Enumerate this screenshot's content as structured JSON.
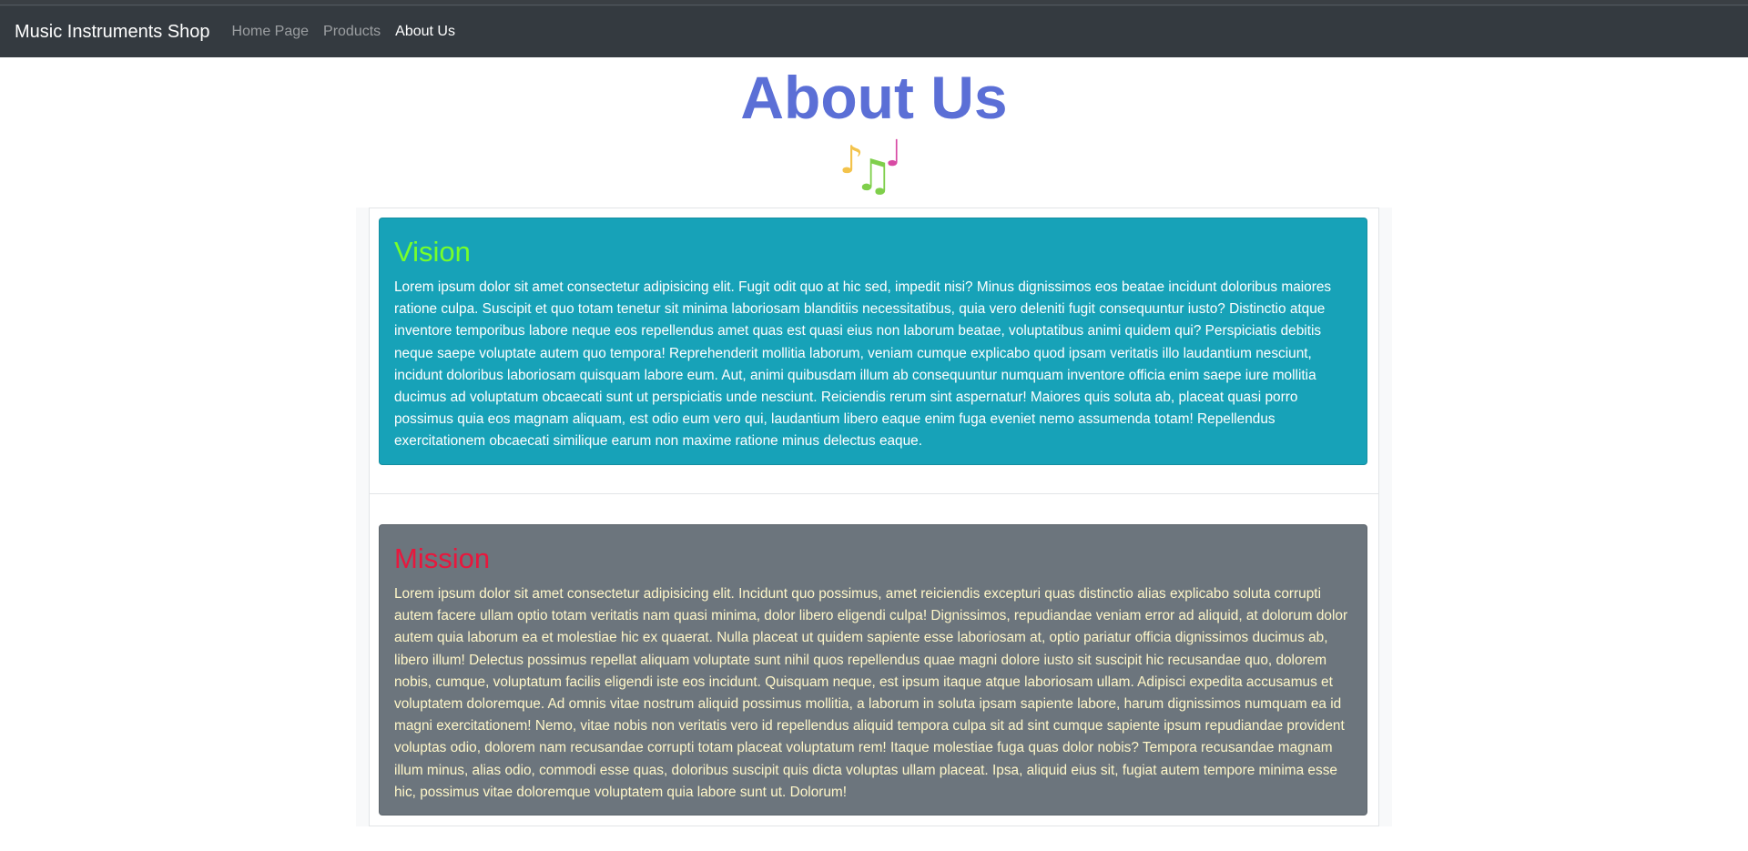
{
  "navbar": {
    "brand": "Music Instruments Shop",
    "links": [
      "Home Page",
      "Products",
      "About Us"
    ],
    "active": "About Us"
  },
  "page": {
    "title": "About Us",
    "notes_icon": "musical-notes-icon"
  },
  "vision": {
    "title": "Vision",
    "text": "Lorem ipsum dolor sit amet consectetur adipisicing elit. Fugit odit quo at hic sed, impedit nisi? Minus dignissimos eos beatae incidunt doloribus maiores ratione culpa. Suscipit et quo totam tenetur sit minima laboriosam blanditiis necessitatibus, quia vero deleniti fugit consequuntur iusto? Distinctio atque inventore temporibus labore neque eos repellendus amet quas est quasi eius non laborum beatae, voluptatibus animi quidem qui? Perspiciatis debitis neque saepe voluptate autem quo tempora! Reprehenderit mollitia laborum, veniam cumque explicabo quod ipsam veritatis illo laudantium nesciunt, incidunt doloribus laboriosam quisquam labore eum. Aut, animi quibusdam illum ab consequuntur numquam inventore officia enim saepe iure mollitia ducimus ad voluptatum obcaecati sunt ut perspiciatis unde nesciunt. Reiciendis rerum sint aspernatur! Maiores quis soluta ab, placeat quasi porro possimus quia eos magnam aliquam, est odio eum vero qui, laudantium libero eaque enim fuga eveniet nemo assumenda totam! Repellendus exercitationem obcaecati similique earum non maxime ratione minus delectus eaque.",
    "bg_color": "#17a2b8",
    "title_color": "#76ff2b"
  },
  "mission": {
    "title": "Mission",
    "text": "Lorem ipsum dolor sit amet consectetur adipisicing elit. Incidunt quo possimus, amet reiciendis excepturi quas distinctio alias explicabo soluta corrupti autem facere ullam optio totam veritatis nam quasi minima, dolor libero eligendi culpa! Dignissimos, repudiandae veniam error ad aliquid, at dolorum dolor autem quia laborum ea et molestiae hic ex quaerat. Nulla placeat ut quidem sapiente esse laboriosam at, optio pariatur officia dignissimos ducimus ab, libero illum! Delectus possimus repellat aliquam voluptate sunt nihil quos repellendus quae magni dolore iusto sit suscipit hic recusandae quo, dolorem nobis, cumque, voluptatum facilis eligendi iste eos incidunt. Quisquam neque, est ipsum itaque atque laboriosam ullam. Adipisci expedita accusamus et voluptatem doloremque. Ad omnis vitae nostrum aliquid possimus mollitia, a laborum in soluta ipsam sapiente labore, harum dignissimos numquam ea id magni exercitationem! Nemo, vitae nobis non veritatis vero id repellendus aliquid tempora culpa sit ad sint cumque sapiente ipsum repudiandae provident voluptas odio, dolorem nam recusandae corrupti totam placeat voluptatum rem! Itaque molestiae fuga quas dolor nobis? Tempora recusandae magnam illum minus, alias odio, commodi esse quas, doloribus suscipit quis dicta voluptas ullam placeat. Ipsa, aliquid eius sit, fugiat autem tempore minima esse hic, possimus vitae doloremque voluptatem quia labore sunt ut. Dolorum!",
    "bg_color": "#6c757d",
    "title_color": "#e8173d"
  }
}
